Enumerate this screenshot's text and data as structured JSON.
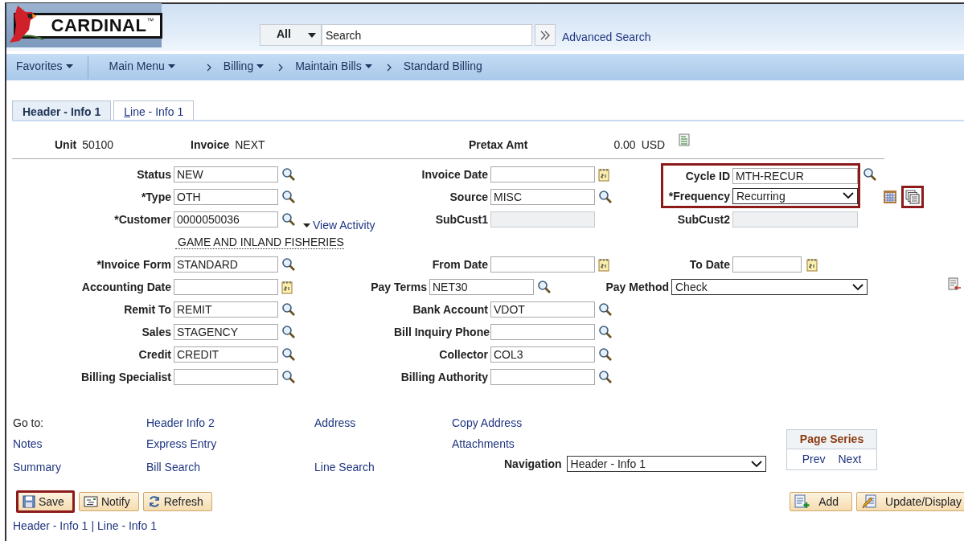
{
  "logo": {
    "text": "CARDINAL",
    "mark": "™"
  },
  "search": {
    "scope": "All",
    "placeholder": "Search",
    "advanced_link": "Advanced Search"
  },
  "menus": [
    {
      "label": "Favorites",
      "dropdown": true
    },
    {
      "label": "Main Menu",
      "dropdown": true
    }
  ],
  "breadcrumb": [
    {
      "label": "Billing",
      "dropdown": true
    },
    {
      "label": "Maintain Bills",
      "dropdown": true
    },
    {
      "label": "Standard Billing",
      "dropdown": false
    }
  ],
  "tabs": [
    {
      "label": "Header - Info 1",
      "selected": true
    },
    {
      "label": "Line - Info 1",
      "selected": false
    }
  ],
  "summary": [
    {
      "label": "Unit",
      "value": "50100",
      "kind": "text"
    },
    {
      "label": "Invoice",
      "value": "NEXT",
      "kind": "text"
    },
    {
      "label": "Pretax Amt",
      "value": "0.00",
      "unit": "USD",
      "kind": "amount"
    }
  ],
  "form_rows": [
    {
      "left": {
        "label": "Status",
        "value": "NEW",
        "kind": "lookup"
      },
      "middle": {
        "label": "Invoice Date",
        "kind": "date"
      },
      "right": {
        "label": "Cycle ID",
        "value": "MTH-RECUR",
        "kind": "lookup",
        "highlighted": true
      }
    },
    {
      "left": {
        "label": "*Type",
        "value": "OTH",
        "kind": "lookup"
      },
      "middle": {
        "label": "Source",
        "value": "MISC",
        "kind": "lookup"
      },
      "right": {
        "label": "*Frequency",
        "value": "Recurring",
        "kind": "select",
        "highlighted": true,
        "icons": [
          {
            "kind": "schedule",
            "highlighted": false
          },
          {
            "kind": "copy",
            "highlighted": true
          }
        ]
      }
    },
    {
      "left": {
        "label": "*Customer",
        "value": "0000050036",
        "kind": "lookup",
        "link": "View Activity"
      },
      "middle": {
        "label": "SubCust1",
        "kind": "disabled"
      },
      "right": {
        "label": "SubCust2",
        "kind": "disabled"
      }
    },
    {
      "left": {
        "description": "GAME AND INLAND FISHERIES",
        "kind": "description"
      }
    },
    {
      "left": {
        "label": "*Invoice Form",
        "value": "STANDARD",
        "kind": "lookup"
      },
      "middle": {
        "label": "From Date",
        "kind": "date"
      },
      "right": {
        "label": "To Date",
        "kind": "date"
      }
    },
    {
      "left": {
        "label": "Accounting Date",
        "kind": "date"
      },
      "middle": {
        "label": "Pay Terms",
        "value": "NET30",
        "kind": "lookup"
      },
      "right": {
        "label": "Pay Method",
        "value": "Check",
        "kind": "wide_select",
        "icons": [
          {
            "kind": "document",
            "highlighted": false
          }
        ]
      }
    },
    {
      "left": {
        "label": "Remit To",
        "value": "REMIT",
        "kind": "lookup"
      },
      "middle": {
        "label": "Bank Account",
        "value": "VDOT",
        "kind": "lookup"
      }
    },
    {
      "left": {
        "label": "Sales",
        "value": "STAGENCY",
        "kind": "lookup"
      },
      "middle": {
        "label": "Bill Inquiry Phone",
        "kind": "lookup"
      }
    },
    {
      "left": {
        "label": "Credit",
        "value": "CREDIT",
        "kind": "lookup"
      },
      "middle": {
        "label": "Collector",
        "value": "COL3",
        "kind": "lookup"
      }
    },
    {
      "left": {
        "label": "Billing Specialist",
        "kind": "lookup"
      },
      "middle": {
        "label": "Billing Authority",
        "kind": "lookup"
      }
    }
  ],
  "goto_rows": [
    [
      {
        "kind": "label",
        "text": "Go to:"
      },
      {
        "kind": "link",
        "text": "Header Info 2"
      },
      {
        "kind": "link",
        "text": "Address"
      },
      {
        "kind": "link",
        "text": "Copy Address"
      }
    ],
    [
      {
        "kind": "link",
        "text": "Notes"
      },
      {
        "kind": "link",
        "text": "Express Entry"
      },
      null,
      {
        "kind": "link",
        "text": "Attachments"
      }
    ],
    [
      {
        "kind": "link",
        "text": "Summary"
      },
      {
        "kind": "link",
        "text": "Bill Search"
      },
      {
        "kind": "link",
        "text": "Line Search"
      }
    ]
  ],
  "navigation": {
    "label": "Navigation",
    "value": "Header - Info 1"
  },
  "page_series": {
    "title": "Page Series",
    "links": [
      "Prev",
      "Next"
    ]
  },
  "buttons_left": [
    {
      "label": "Save",
      "kind": "save",
      "highlighted": true
    },
    {
      "label": "Notify",
      "kind": "notify",
      "highlighted": false
    },
    {
      "label": "Refresh",
      "kind": "refresh",
      "highlighted": false
    }
  ],
  "buttons_right": [
    {
      "label": "Add",
      "kind": "add",
      "highlighted": false
    },
    {
      "label": "Update/Display",
      "kind": "update",
      "highlighted": false
    }
  ],
  "footer": {
    "links": [
      "Header - Info 1",
      "Line - Info 1"
    ],
    "separator": "|"
  }
}
